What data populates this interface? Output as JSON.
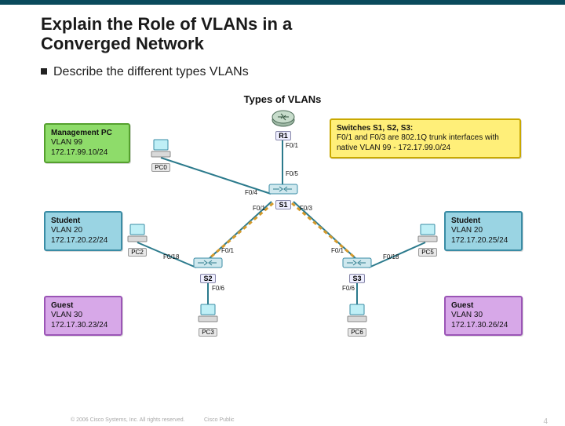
{
  "title_line1": "Explain the Role of VLANs in a",
  "title_line2": "Converged Network",
  "bullet": "Describe the different types VLANs",
  "diagram_title": "Types of VLANs",
  "legend": {
    "mgmt": {
      "title": "Management PC",
      "vlan": "VLAN 99",
      "ip": "172.17.99.10/24"
    },
    "stu_l": {
      "title": "Student",
      "vlan": "VLAN 20",
      "ip": "172.17.20.22/24"
    },
    "guest_l": {
      "title": "Guest",
      "vlan": "VLAN 30",
      "ip": "172.17.30.23/24"
    },
    "note": {
      "title": "Switches S1, S2, S3:",
      "line1": "F0/1 and F0/3 are 802.1Q trunk interfaces with",
      "line2": "native VLAN 99 - 172.17.99.0/24"
    },
    "stu_r": {
      "title": "Student",
      "vlan": "VLAN 20",
      "ip": "172.17.20.25/24"
    },
    "guest_r": {
      "title": "Guest",
      "vlan": "VLAN 30",
      "ip": "172.17.30.26/24"
    }
  },
  "devices": {
    "r1": "R1",
    "s1": "S1",
    "s2": "S2",
    "s3": "S3",
    "pc0": "PC0",
    "pc2": "PC2",
    "pc3": "PC3",
    "pc5": "PC5",
    "pc6": "PC6"
  },
  "ports": {
    "r1_s1": "F0/1",
    "s1_r1": "F0/5",
    "s1_left": "F0/4",
    "s1_s2": "F0/1",
    "s1_s3": "F0/3",
    "s2_s1": "F0/1",
    "s3_s1": "F0/1",
    "s2_pc2": "F0/18",
    "s2_pc3": "F0/6",
    "s3_pc5": "F0/18",
    "s3_pc6": "F0/6"
  },
  "footer": {
    "copy": "© 2006 Cisco Systems, Inc. All rights reserved.",
    "pub": "Cisco Public",
    "page": "4"
  }
}
